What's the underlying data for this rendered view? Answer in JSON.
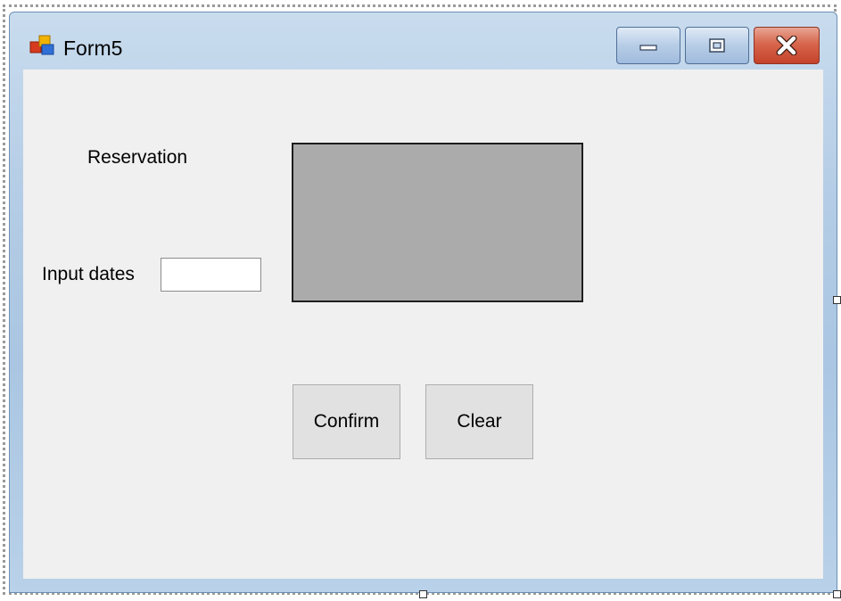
{
  "window": {
    "title": "Form5",
    "icon": "winforms-app-icon",
    "controls": {
      "minimize_icon": "minimize-icon",
      "maximize_icon": "maximize-icon",
      "close_icon": "close-icon",
      "close_color": "#c4432a"
    }
  },
  "form": {
    "reservation_label": "Reservation",
    "input_dates_label": "Input dates",
    "input_dates_value": "",
    "panel_color": "#ababab",
    "confirm_label": "Confirm",
    "clear_label": "Clear"
  }
}
